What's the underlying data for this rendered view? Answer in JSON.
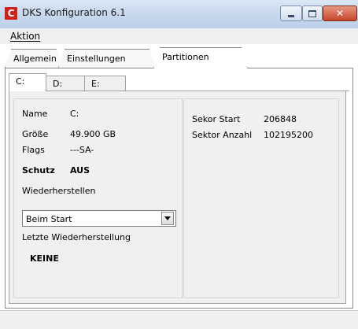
{
  "window": {
    "icon_letter": "C",
    "title": "DKS Konfiguration 6.1"
  },
  "menu": {
    "aktion": "Aktion"
  },
  "tabs": [
    {
      "label": "Allgemein"
    },
    {
      "label": "Einstellungen"
    },
    {
      "label": "Partitionen",
      "selected": true
    }
  ],
  "drive_tabs": [
    {
      "label": "C:",
      "selected": true
    },
    {
      "label": "D:"
    },
    {
      "label": "E:"
    }
  ],
  "partition": {
    "name_label": "Name",
    "name_value": "C:",
    "size_label": "Größe",
    "size_value": "49.900 GB",
    "flags_label": "Flags",
    "flags_value": "---SA-",
    "schutz_label": "Schutz",
    "schutz_value": "AUS",
    "restore_label": "Wiederherstellen",
    "restore_select_value": "Beim Start",
    "last_restore_label": "Letzte Wiederherstellung",
    "last_restore_value": "KEINE",
    "sector_start_label": "Sekor Start",
    "sector_start_value": "206848",
    "sector_count_label": "Sektor Anzahl",
    "sector_count_value": "102195200"
  },
  "colors": {
    "icon_red": "#d0201a",
    "close_button": "#c5452a",
    "panel_background": "#f0f0f0"
  }
}
